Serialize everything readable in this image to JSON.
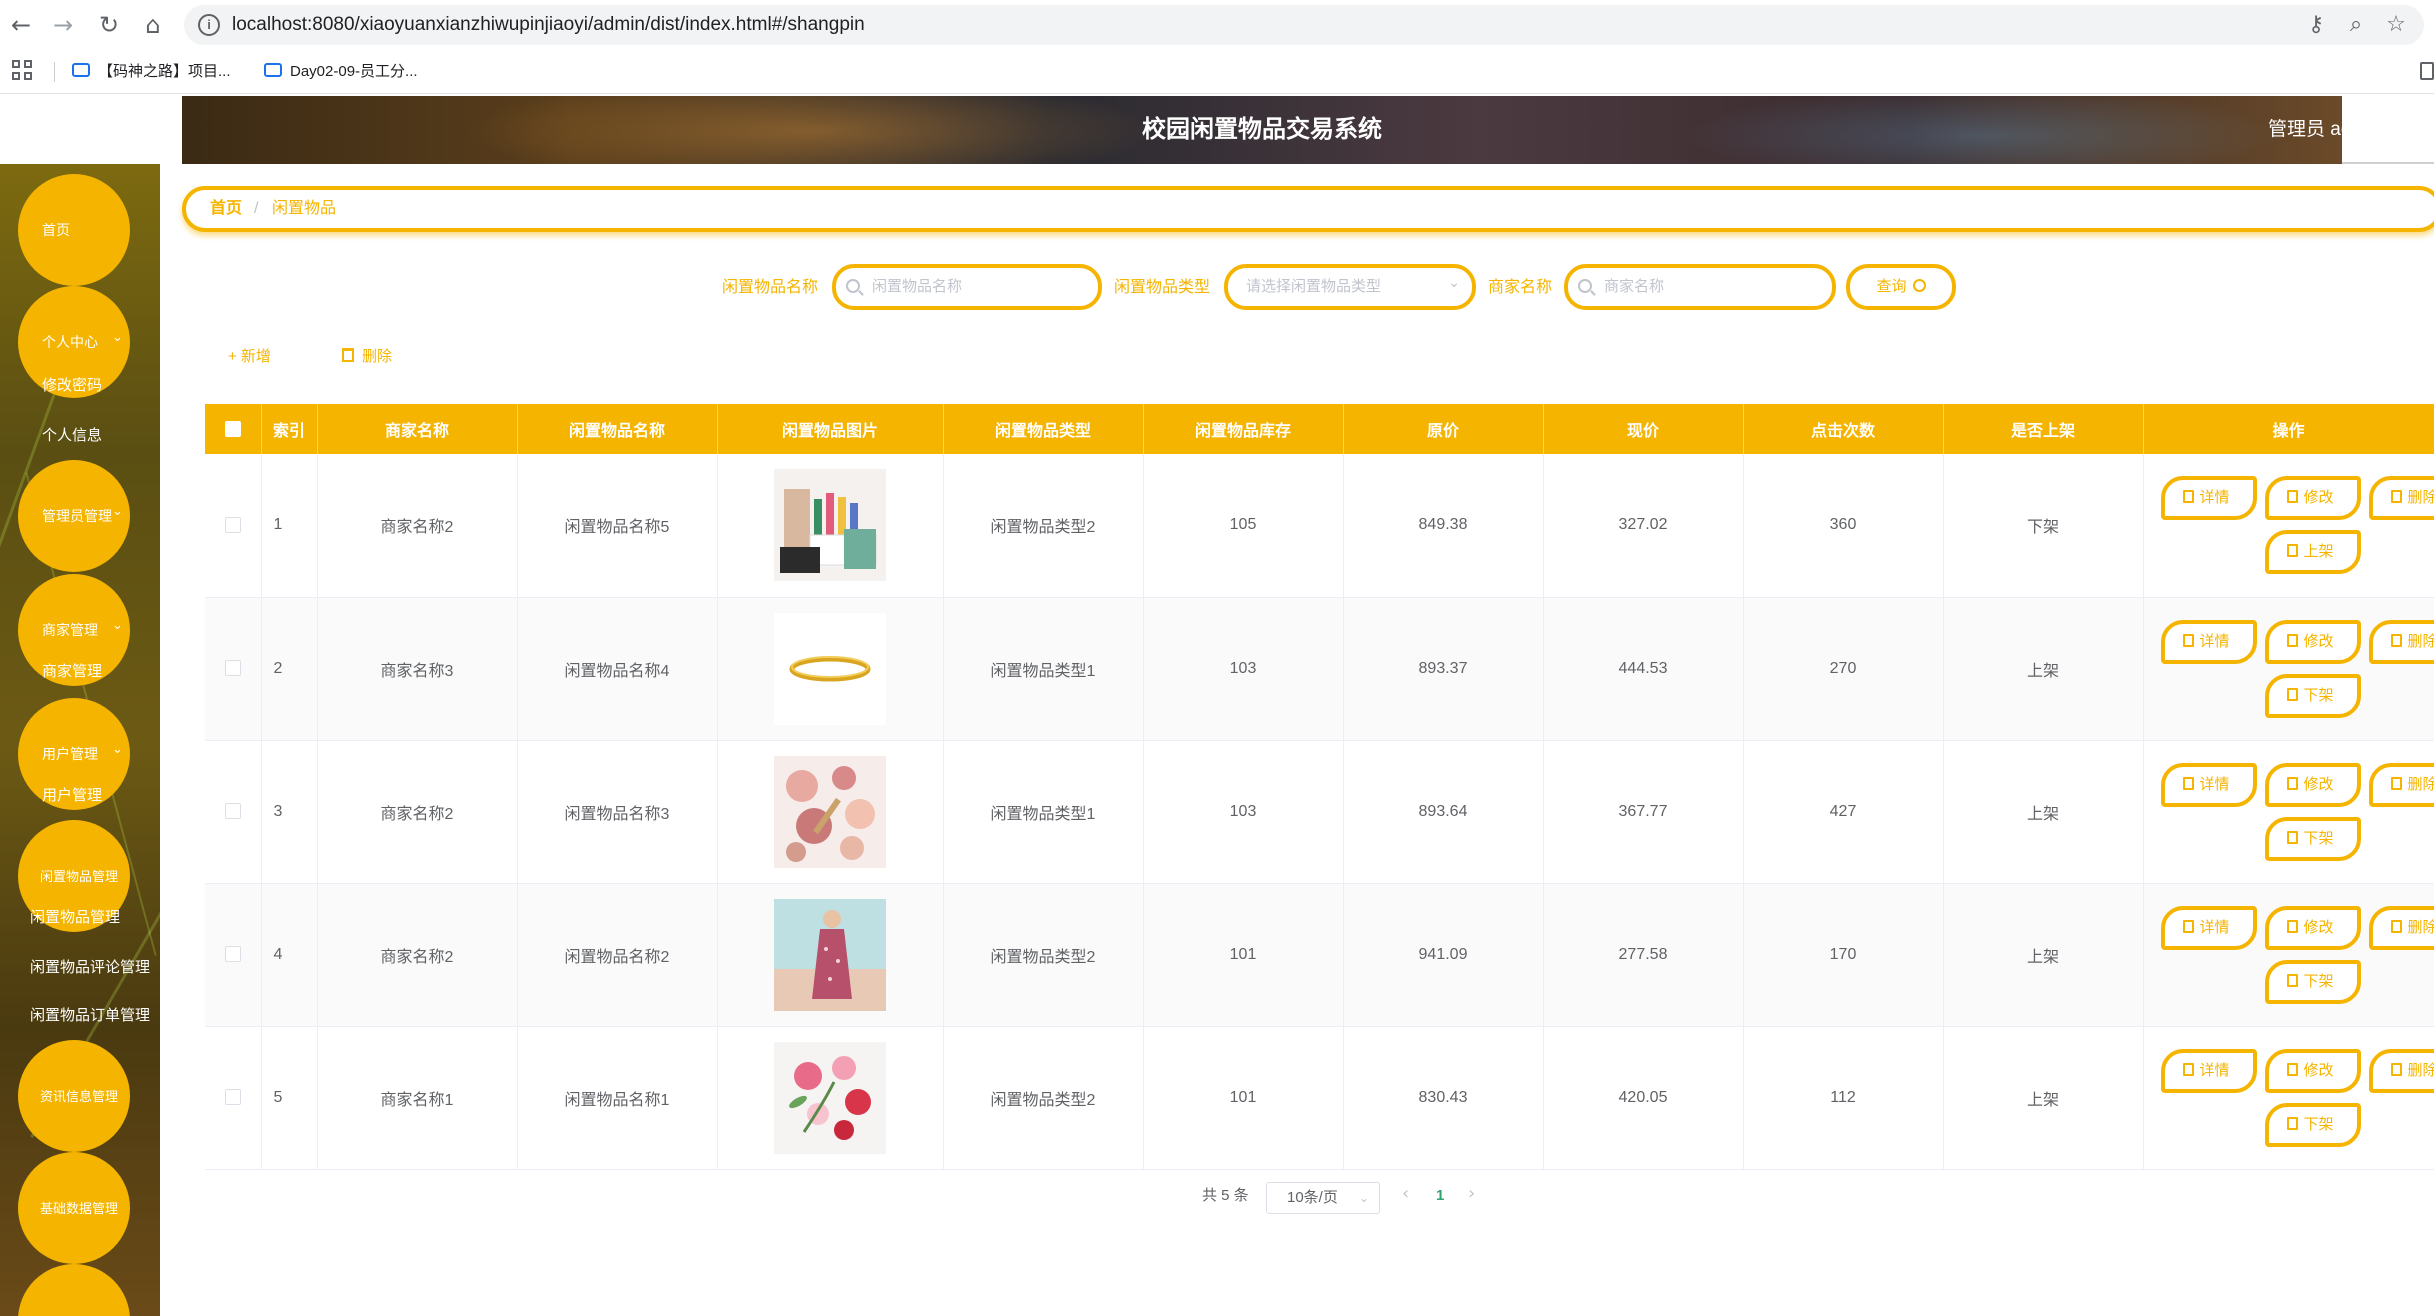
{
  "browser": {
    "url": "localhost:8080/xiaoyuanxianzhiwupinjiaoyi/admin/dist/index.html#/shangpin",
    "bookmarks": [
      "【码神之路】项目...",
      "Day02-09-员工分..."
    ]
  },
  "header": {
    "title": "校园闲置物品交易系统",
    "user": "管理员 ad"
  },
  "sidebar": {
    "items": [
      {
        "label": "首页"
      },
      {
        "label": "个人中心",
        "children": [
          "修改密码",
          "个人信息"
        ]
      },
      {
        "label": "管理员管理"
      },
      {
        "label": "商家管理",
        "children": [
          "商家管理"
        ]
      },
      {
        "label": "用户管理",
        "children": [
          "用户管理"
        ]
      },
      {
        "label": "闲置物品管理",
        "children": [
          "闲置物品管理",
          "闲置物品评论管理",
          "闲置物品订单管理"
        ]
      },
      {
        "label": "资讯信息管理"
      },
      {
        "label": "基础数据管理"
      }
    ]
  },
  "breadcrumb": {
    "home": "首页",
    "separator": "/",
    "current": "闲置物品"
  },
  "search": {
    "name_label": "闲置物品名称",
    "name_placeholder": "闲置物品名称",
    "type_label": "闲置物品类型",
    "type_placeholder": "请选择闲置物品类型",
    "merchant_label": "商家名称",
    "merchant_placeholder": "商家名称",
    "query_label": "查询"
  },
  "actions": {
    "add": "+ 新增",
    "delete": "删除"
  },
  "table": {
    "columns": [
      "索引",
      "商家名称",
      "闲置物品名称",
      "闲置物品图片",
      "闲置物品类型",
      "闲置物品库存",
      "原价",
      "现价",
      "点击次数",
      "是否上架",
      "操作"
    ],
    "rows": [
      {
        "index": "1",
        "merchant": "商家名称2",
        "name": "闲置物品名称5",
        "image": "cosmetics-organizer",
        "type": "闲置物品类型2",
        "stock": "105",
        "original_price": "849.38",
        "current_price": "327.02",
        "clicks": "360",
        "listed": "下架",
        "toggle": "上架"
      },
      {
        "index": "2",
        "merchant": "商家名称3",
        "name": "闲置物品名称4",
        "image": "gold-bracelet",
        "type": "闲置物品类型1",
        "stock": "103",
        "original_price": "893.37",
        "current_price": "444.53",
        "clicks": "270",
        "listed": "上架",
        "toggle": "下架"
      },
      {
        "index": "3",
        "merchant": "商家名称2",
        "name": "闲置物品名称3",
        "image": "makeup-powders",
        "type": "闲置物品类型1",
        "stock": "103",
        "original_price": "893.64",
        "current_price": "367.77",
        "clicks": "427",
        "listed": "上架",
        "toggle": "下架"
      },
      {
        "index": "4",
        "merchant": "商家名称2",
        "name": "闲置物品名称2",
        "image": "floral-dress",
        "type": "闲置物品类型2",
        "stock": "101",
        "original_price": "941.09",
        "current_price": "277.58",
        "clicks": "170",
        "listed": "上架",
        "toggle": "下架"
      },
      {
        "index": "5",
        "merchant": "商家名称1",
        "name": "闲置物品名称1",
        "image": "flowers",
        "type": "闲置物品类型2",
        "stock": "101",
        "original_price": "830.43",
        "current_price": "420.05",
        "clicks": "112",
        "listed": "上架",
        "toggle": "下架"
      }
    ],
    "op_labels": {
      "detail": "详情",
      "edit": "修改",
      "delete": "删除"
    }
  },
  "pagination": {
    "total": "共 5 条",
    "page_size": "10条/页",
    "current_page": "1"
  },
  "colors": {
    "accent": "#f5b400",
    "text": "#606266",
    "active_page": "#2fa66a"
  }
}
